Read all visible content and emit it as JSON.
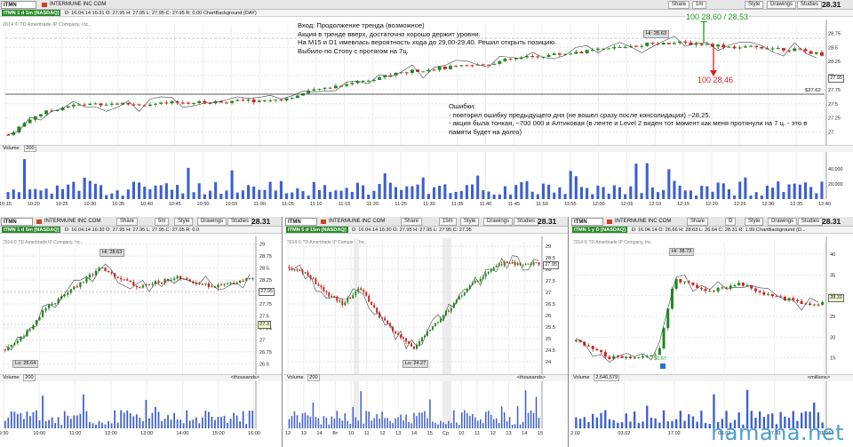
{
  "top": {
    "symbol": "ITMN",
    "company": "INTERMUNE INC COM",
    "ticker_label": "ITMN 1 d 1m [NASDAQ]",
    "info": "D: 16.04.14 16:31  O: 27.95  H: 27.95  L: 27.95  C: 27.95  R: 0.00  ChartBackground (DAY)",
    "copyright": "2014 © TD Ameritrade IP Company, Inc.",
    "price": "28.31",
    "buttons": {
      "share": "Share",
      "period": "1m",
      "style": "Style",
      "drawings": "Drawings",
      "studies": "Studies"
    },
    "current_label": "27.95",
    "line_label": "$27.62",
    "volume_label": "Volume",
    "volume_value": "200",
    "entry_note": [
      "Вход:  Продолжение тренда (возможное)",
      "Акция в тренде вверх, достаточно хорошо держит уровни.",
      "На M15 и D1 имевлась вероятность хода до 29,00-29,40. Решил открыть позицию.",
      "Выбило по Стопу с протягом на 7ц."
    ],
    "errors_note": [
      "Ошибки:",
      "- повторил ошибку предыдущего дня (не вошел сразу после консолидации) ~28,25.",
      "- акция была тонкая, ~700 000 и Алтиковая (в ленте и Level 2 виден тот момент как меня протянули на 7 ц. - это в",
      "памяти будет на долго)"
    ],
    "buy_annotation": "100 28,60 / 28,53",
    "sell_annotation": "100 28,46",
    "hi_label": "Hi: 28.63"
  },
  "bottom_left": {
    "symbol": "ITMN",
    "company": "INTERMUNE INC COM",
    "ticker_label": "ITMN 1 d 5m [NASDAQ]",
    "info": "D: 16.04.14 16:30  O: 27.95  H: 27.95  L: 27.95  C: 27.95  R: 0.0",
    "copyright": "2014 © TD Ameritrade IP Company, Inc.",
    "price": "28.31",
    "period": "5m",
    "hi_label": "Hi: 28.63",
    "lo_label": "Lo: 26.64",
    "volume_label": "Volume",
    "volume_value": "200",
    "units": "<thousands>",
    "price_tag": "27.95",
    "price_tag2": "27.3"
  },
  "bottom_mid": {
    "symbol": "ITMN",
    "company": "INTERMUNE INC COM",
    "ticker_label": "ITMN 5 d 15m [NASDAQ]",
    "info": "D: 16.04.14 16:30  O: 27.95  H: 27.95  L: 27.95  C: 27.95",
    "copyright": "2014 © TD Ameritrade IP Company, Inc.",
    "price": "28.31",
    "period": "15m",
    "hi_label": "Hi: 28.63",
    "lo_label": "Lo: 24.27",
    "volume_label": "Volume",
    "volume_value": "200",
    "units": "<thousands>",
    "price_tag": "27.95"
  },
  "bottom_right": {
    "symbol": "ITMN",
    "company": "INTERMUNE INC COM",
    "ticker_label": "ITMN 1 y D [NASDAQ]",
    "info": "D: 16.04.14  O: 26.66  H: 28.63  L: 26.64  C: 28.31  R: 1.99  ChartBackground (D...",
    "copyright": "2014 © TD Ameritrade IP Company, Inc.",
    "price": "28.31",
    "period": "D",
    "hi_label": "Hi: 38.73",
    "div_label": "$0.67",
    "volume_label": "Volume",
    "volume_value": "2,646,579",
    "units": "<millions>",
    "price_tag": "28.31"
  },
  "common_buttons": {
    "share": "Share",
    "style": "Style",
    "drawings": "Drawings",
    "studies": "Studies"
  },
  "watermark": "hamana.net",
  "chart_data": [
    {
      "type": "candlestick",
      "title": "ITMN 1 d 1m [NASDAQ]",
      "x": [
        "10:15",
        "10:20",
        "10:25",
        "10:30",
        "10:35",
        "10:40",
        "10:45",
        "10:50",
        "10:55",
        "11:00",
        "11:05",
        "11:10",
        "11:15",
        "11:20",
        "11:25",
        "11:30",
        "11:35",
        "11:40",
        "11:45",
        "11:50",
        "11:55",
        "12:00",
        "12:05",
        "12:10",
        "12:15",
        "12:20",
        "12:25",
        "12:30",
        "12:35",
        "12:40"
      ],
      "y_ticks": [
        27,
        27.25,
        27.5,
        27.75,
        28,
        28.25,
        28.5,
        28.75
      ],
      "ylim": [
        26.85,
        28.9
      ],
      "close_approx": [
        26.95,
        27.3,
        27.45,
        27.5,
        27.5,
        27.48,
        27.52,
        27.52,
        27.55,
        27.55,
        27.6,
        27.75,
        27.85,
        27.95,
        28.05,
        28.12,
        28.15,
        28.2,
        28.3,
        28.35,
        28.4,
        28.45,
        28.52,
        28.58,
        28.58,
        28.55,
        28.5,
        28.5,
        28.46,
        28.38
      ],
      "volume_y_ticks": [
        20000,
        40000
      ]
    },
    {
      "type": "candlestick",
      "title": "ITMN 1 d 5m [NASDAQ]",
      "x": [
        "9:30",
        "10:00",
        "11:00",
        "12:00",
        "13:00",
        "14:00",
        "15:00",
        "16:00"
      ],
      "y_ticks": [
        26.5,
        26.75,
        27,
        27.25,
        27.5,
        27.75,
        28,
        28.25,
        28.5,
        28.75,
        29
      ],
      "ylim": [
        26.45,
        29.05
      ],
      "close_approx": [
        26.8,
        27.1,
        27.6,
        27.9,
        28.2,
        28.5,
        28.3,
        28.1,
        28.2,
        28.3,
        28.2,
        28.1,
        28.2,
        28.3
      ]
    },
    {
      "type": "candlestick",
      "title": "ITMN 5 d 15m [NASDAQ]",
      "x": [
        "12",
        "13",
        "14",
        "Вт",
        "10",
        "11",
        "12",
        "13",
        "14",
        "15",
        "Ср",
        "10",
        "11",
        "12",
        "13",
        "14",
        "15"
      ],
      "y_ticks": [
        24,
        24.5,
        25,
        25.5,
        26,
        26.5,
        27,
        27.5,
        28,
        28.5,
        29
      ],
      "ylim": [
        23.8,
        29.2
      ],
      "close_approx": [
        28.1,
        27.8,
        27.0,
        26.5,
        27.2,
        26.0,
        25.2,
        24.6,
        25.5,
        26.3,
        27.2,
        27.8,
        28.3,
        28.2,
        28.3
      ]
    },
    {
      "type": "candlestick",
      "title": "ITMN 1 y D [NASDAQ]",
      "x": [
        "02.02",
        "03.02",
        "17.02",
        "03.03",
        "17.03",
        "01.04"
      ],
      "y_ticks": [
        15,
        20,
        25,
        30,
        35,
        40
      ],
      "ylim": [
        13,
        43
      ],
      "close_approx": [
        19,
        17,
        15,
        15,
        15,
        16,
        34,
        33,
        31,
        32,
        33,
        31,
        30,
        29,
        28,
        28
      ]
    }
  ]
}
